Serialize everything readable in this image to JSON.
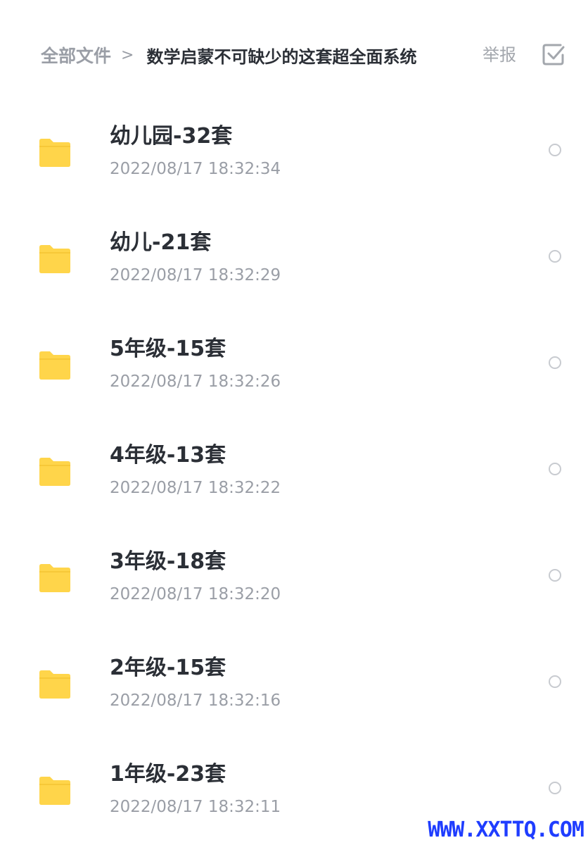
{
  "header": {
    "breadcrumb_root": "全部文件",
    "breadcrumb_separator": ">",
    "breadcrumb_current": "数学启蒙不可缺少的这套超全面系统",
    "report_label": "举报",
    "multi_select_icon": "checkbox-icon"
  },
  "colors": {
    "folder": "#FFD54A",
    "text_primary": "#2B2F36",
    "text_secondary": "#9A9EA6",
    "watermark": "#1F3DFF"
  },
  "files": [
    {
      "name": "幼儿园-32套",
      "date": "2022/08/17 18:32:34",
      "icon": "folder-icon"
    },
    {
      "name": "幼儿-21套",
      "date": "2022/08/17 18:32:29",
      "icon": "folder-icon"
    },
    {
      "name": "5年级-15套",
      "date": "2022/08/17 18:32:26",
      "icon": "folder-icon"
    },
    {
      "name": "4年级-13套",
      "date": "2022/08/17 18:32:22",
      "icon": "folder-icon"
    },
    {
      "name": "3年级-18套",
      "date": "2022/08/17 18:32:20",
      "icon": "folder-icon"
    },
    {
      "name": "2年级-15套",
      "date": "2022/08/17 18:32:16",
      "icon": "folder-icon"
    },
    {
      "name": "1年级-23套",
      "date": "2022/08/17 18:32:11",
      "icon": "folder-icon"
    }
  ],
  "watermark": "WWW.XXTTQ.COM"
}
